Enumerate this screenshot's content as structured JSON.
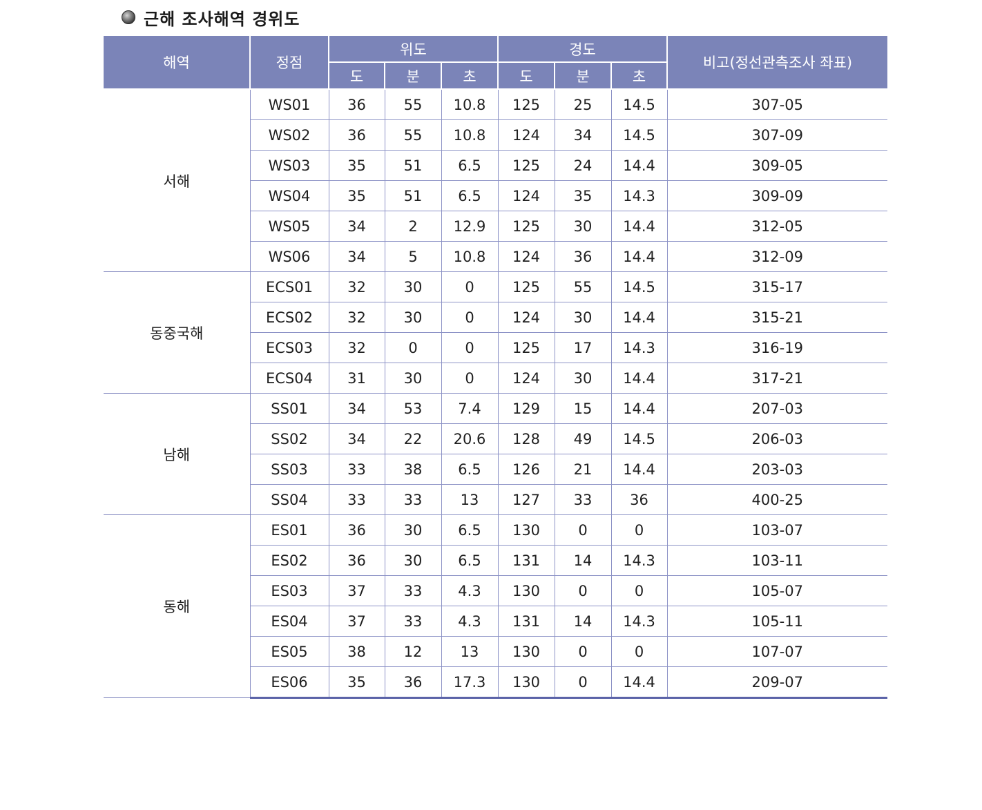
{
  "title": "근해 조사해역 경위도",
  "header": {
    "region": "해역",
    "station": "정점",
    "latitude": "위도",
    "longitude": "경도",
    "note": "비고(정선관측조사 좌표)",
    "deg": "도",
    "min": "분",
    "sec": "초"
  },
  "groups": [
    {
      "region": "서해",
      "rows": [
        [
          "WS01",
          "36",
          "55",
          "10.8",
          "125",
          "25",
          "14.5",
          "307-05"
        ],
        [
          "WS02",
          "36",
          "55",
          "10.8",
          "124",
          "34",
          "14.5",
          "307-09"
        ],
        [
          "WS03",
          "35",
          "51",
          "6.5",
          "125",
          "24",
          "14.4",
          "309-05"
        ],
        [
          "WS04",
          "35",
          "51",
          "6.5",
          "124",
          "35",
          "14.3",
          "309-09"
        ],
        [
          "WS05",
          "34",
          "2",
          "12.9",
          "125",
          "30",
          "14.4",
          "312-05"
        ],
        [
          "WS06",
          "34",
          "5",
          "10.8",
          "124",
          "36",
          "14.4",
          "312-09"
        ]
      ]
    },
    {
      "region": "동중국해",
      "rows": [
        [
          "ECS01",
          "32",
          "30",
          "0",
          "125",
          "55",
          "14.5",
          "315-17"
        ],
        [
          "ECS02",
          "32",
          "30",
          "0",
          "124",
          "30",
          "14.4",
          "315-21"
        ],
        [
          "ECS03",
          "32",
          "0",
          "0",
          "125",
          "17",
          "14.3",
          "316-19"
        ],
        [
          "ECS04",
          "31",
          "30",
          "0",
          "124",
          "30",
          "14.4",
          "317-21"
        ]
      ]
    },
    {
      "region": "남해",
      "rows": [
        [
          "SS01",
          "34",
          "53",
          "7.4",
          "129",
          "15",
          "14.4",
          "207-03"
        ],
        [
          "SS02",
          "34",
          "22",
          "20.6",
          "128",
          "49",
          "14.5",
          "206-03"
        ],
        [
          "SS03",
          "33",
          "38",
          "6.5",
          "126",
          "21",
          "14.4",
          "203-03"
        ],
        [
          "SS04",
          "33",
          "33",
          "13",
          "127",
          "33",
          "36",
          "400-25"
        ]
      ]
    },
    {
      "region": "동해",
      "rows": [
        [
          "ES01",
          "36",
          "30",
          "6.5",
          "130",
          "0",
          "0",
          "103-07"
        ],
        [
          "ES02",
          "36",
          "30",
          "6.5",
          "131",
          "14",
          "14.3",
          "103-11"
        ],
        [
          "ES03",
          "37",
          "33",
          "4.3",
          "130",
          "0",
          "0",
          "105-07"
        ],
        [
          "ES04",
          "37",
          "33",
          "4.3",
          "131",
          "14",
          "14.3",
          "105-11"
        ],
        [
          "ES05",
          "38",
          "12",
          "13",
          "130",
          "0",
          "0",
          "107-07"
        ],
        [
          "ES06",
          "35",
          "36",
          "17.3",
          "130",
          "0",
          "14.4",
          "209-07"
        ]
      ]
    }
  ]
}
